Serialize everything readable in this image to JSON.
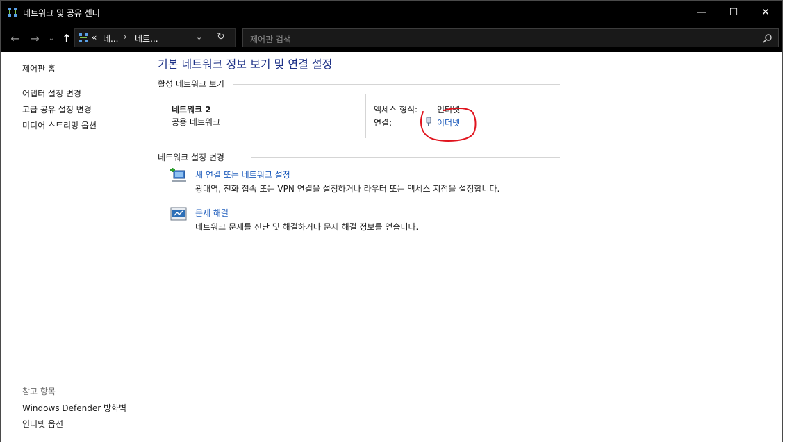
{
  "window": {
    "title": "네트워크 및 공유 센터",
    "controls": {
      "minimize": "—",
      "maximize": "☐",
      "close": "✕"
    }
  },
  "navigation": {
    "back": "←",
    "forward": "→",
    "recent": "⌄",
    "up": "↑",
    "address": {
      "prefix": "«",
      "crumb1": "네...",
      "sep": "›",
      "crumb2": "네트...",
      "dropdown": "⌄",
      "refresh": "↻"
    },
    "search": {
      "placeholder": "제어판 검색"
    }
  },
  "sidebar": {
    "home": "제어판 홈",
    "links": [
      "어댑터 설정 변경",
      "고급 공유 설정 변경",
      "미디어 스트리밍 옵션"
    ],
    "see_also_title": "참고 항목",
    "see_also": [
      "Windows Defender 방화벽",
      "인터넷 옵션"
    ]
  },
  "main": {
    "title": "기본 네트워크 정보 보기 및 연결 설정",
    "active_section": {
      "header": "활성 네트워크 보기",
      "network_name": "네트워크 2",
      "network_type": "공용 네트워크",
      "access_label": "액세스 형식:",
      "access_value": "인터넷",
      "connection_label": "연결:",
      "connection_value": "이더넷"
    },
    "change_section": {
      "header": "네트워크 설정 변경",
      "items": [
        {
          "title": "새 연결 또는 네트워크 설정",
          "desc": "광대역, 전화 접속 또는 VPN 연결을 설정하거나 라우터 또는 액세스 지점을 설정합니다."
        },
        {
          "title": "문제 해결",
          "desc": "네트워크 문제를 진단 및 해결하거나 문제 해결 정보를 얻습니다."
        }
      ]
    }
  },
  "colors": {
    "link": "#1e5cbc",
    "title": "#1e3287",
    "titlebar": "#000000",
    "annotation": "#e0141e"
  }
}
